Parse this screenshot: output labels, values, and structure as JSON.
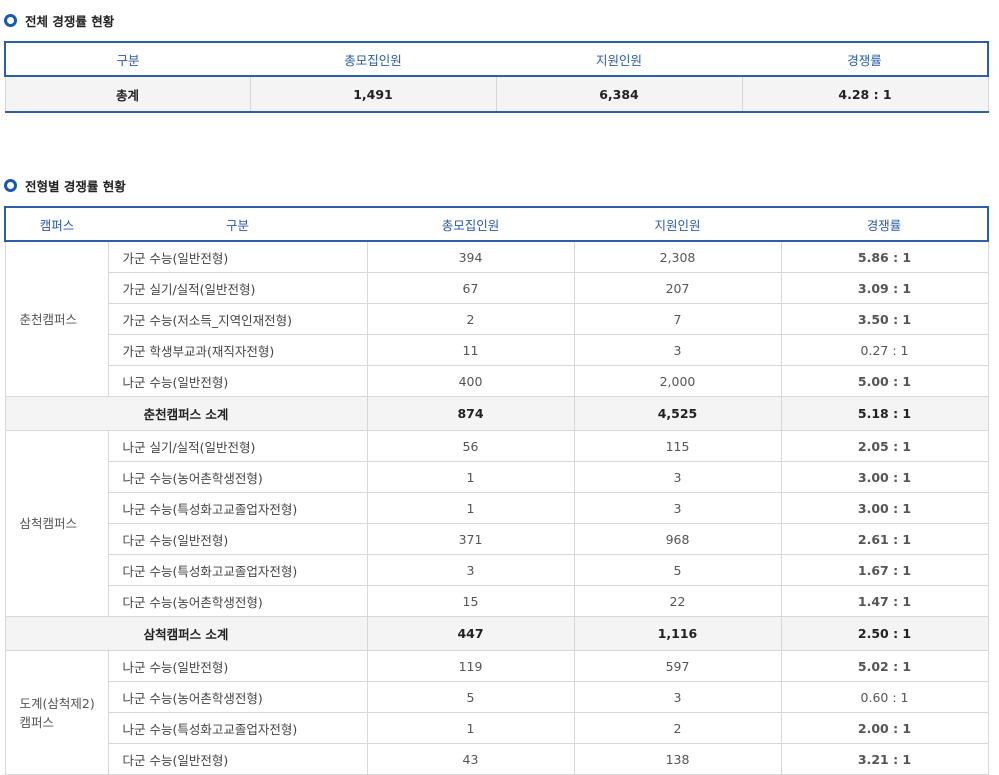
{
  "overall": {
    "title": "전체 경쟁률 현황",
    "headers": [
      "구분",
      "총모집인원",
      "지원인원",
      "경쟁률"
    ],
    "row": {
      "label": "총계",
      "recruit": "1,491",
      "applicants": "6,384",
      "rate": "4.28 : 1"
    }
  },
  "by_type": {
    "title": "전형별 경쟁률 현황",
    "headers": [
      "캠퍼스",
      "구분",
      "총모집인원",
      "지원인원",
      "경쟁률"
    ],
    "campuses": [
      {
        "name": "춘천캠퍼스",
        "rows": [
          {
            "type": "가군 수능(일반전형)",
            "recruit": "394",
            "applicants": "2,308",
            "rate": "5.86 : 1",
            "style": "red"
          },
          {
            "type": "가군 실기/실적(일반전형)",
            "recruit": "67",
            "applicants": "207",
            "rate": "3.09 : 1",
            "style": "blue"
          },
          {
            "type": "가군 수능(저소득_지역인재전형)",
            "recruit": "2",
            "applicants": "7",
            "rate": "3.50 : 1",
            "style": "blue"
          },
          {
            "type": "가군 학생부교과(재직자전형)",
            "recruit": "11",
            "applicants": "3",
            "rate": "0.27 : 1",
            "style": "plain"
          },
          {
            "type": "나군 수능(일반전형)",
            "recruit": "400",
            "applicants": "2,000",
            "rate": "5.00 : 1",
            "style": "red"
          }
        ],
        "subtotal": {
          "label": "춘천캠퍼스 소계",
          "recruit": "874",
          "applicants": "4,525",
          "rate": "5.18 : 1",
          "style": "red"
        }
      },
      {
        "name": "삼척캠퍼스",
        "rows": [
          {
            "type": "나군 실기/실적(일반전형)",
            "recruit": "56",
            "applicants": "115",
            "rate": "2.05 : 1",
            "style": "gray"
          },
          {
            "type": "나군 수능(농어촌학생전형)",
            "recruit": "1",
            "applicants": "3",
            "rate": "3.00 : 1",
            "style": "blue"
          },
          {
            "type": "나군 수능(특성화고교졸업자전형)",
            "recruit": "1",
            "applicants": "3",
            "rate": "3.00 : 1",
            "style": "blue"
          },
          {
            "type": "다군 수능(일반전형)",
            "recruit": "371",
            "applicants": "968",
            "rate": "2.61 : 1",
            "style": "gray"
          },
          {
            "type": "다군 수능(특성화고교졸업자전형)",
            "recruit": "3",
            "applicants": "5",
            "rate": "1.67 : 1",
            "style": "gray"
          },
          {
            "type": "다군 수능(농어촌학생전형)",
            "recruit": "15",
            "applicants": "22",
            "rate": "1.47 : 1",
            "style": "gray"
          }
        ],
        "subtotal": {
          "label": "삼척캠퍼스 소계",
          "recruit": "447",
          "applicants": "1,116",
          "rate": "2.50 : 1",
          "style": "gray"
        }
      },
      {
        "name": "도계(삼척제2)\n캠퍼스",
        "rows": [
          {
            "type": "나군 수능(일반전형)",
            "recruit": "119",
            "applicants": "597",
            "rate": "5.02 : 1",
            "style": "red"
          },
          {
            "type": "나군 수능(농어촌학생전형)",
            "recruit": "5",
            "applicants": "3",
            "rate": "0.60 : 1",
            "style": "plain"
          },
          {
            "type": "나군 수능(특성화고교졸업자전형)",
            "recruit": "1",
            "applicants": "2",
            "rate": "2.00 : 1",
            "style": "gray"
          },
          {
            "type": "다군 수능(일반전형)",
            "recruit": "43",
            "applicants": "138",
            "rate": "3.21 : 1",
            "style": "blue"
          }
        ]
      }
    ]
  },
  "colors": {
    "accent": "#2c5fa8",
    "rate_red": "#d40000",
    "rate_blue": "#2b4fc0"
  }
}
